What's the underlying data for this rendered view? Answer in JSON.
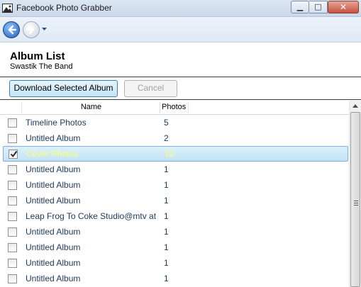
{
  "window": {
    "title": "Facebook Photo Grabber",
    "minimize_glyph": "▁",
    "maximize_glyph": "□",
    "close_glyph": "✕"
  },
  "nav": {
    "back_icon": "back-arrow-icon",
    "forward_icon": "forward-arrow-icon",
    "history_icon": "chevron-down-icon"
  },
  "header": {
    "title": "Album List",
    "subtitle": "Swastik The Band"
  },
  "toolbar": {
    "download_label": "Download Selected Album",
    "cancel_label": "Cancel"
  },
  "table": {
    "columns": [
      "",
      "Name",
      "Photos"
    ],
    "rows": [
      {
        "name": "Timeline Photos",
        "photos": "5",
        "checked": false,
        "selected": false
      },
      {
        "name": "Untitled Album",
        "photos": "2",
        "checked": false,
        "selected": false
      },
      {
        "name": "Cover Photos",
        "photos": "10",
        "checked": true,
        "selected": true
      },
      {
        "name": "Untitled Album",
        "photos": "1",
        "checked": false,
        "selected": false
      },
      {
        "name": "Untitled Album",
        "photos": "1",
        "checked": false,
        "selected": false
      },
      {
        "name": "Untitled Album",
        "photos": "1",
        "checked": false,
        "selected": false
      },
      {
        "name": "Leap Frog To Coke Studio@mtv at",
        "photos": "1",
        "checked": false,
        "selected": false
      },
      {
        "name": "Untitled Album",
        "photos": "1",
        "checked": false,
        "selected": false
      },
      {
        "name": "Untitled Album",
        "photos": "1",
        "checked": false,
        "selected": false
      },
      {
        "name": "Untitled Album",
        "photos": "1",
        "checked": false,
        "selected": false
      },
      {
        "name": "Untitled Album",
        "photos": "1",
        "checked": false,
        "selected": false
      }
    ]
  },
  "colors": {
    "selected_text": "#ffff66",
    "row_text": "#1e395b",
    "selection_border": "#84acdd"
  }
}
